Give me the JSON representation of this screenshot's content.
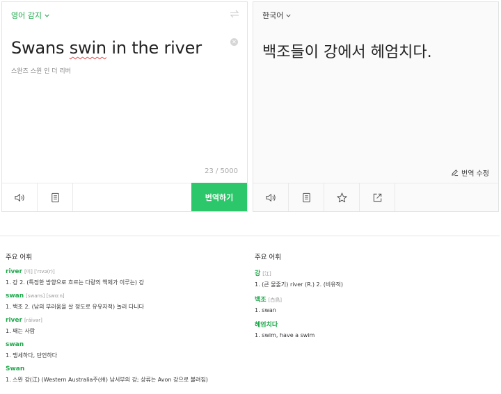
{
  "source": {
    "lang_label": "영어 감지",
    "text_before": "Swans ",
    "text_error": "swin",
    "text_after": " in the river",
    "pronunciation": "스완즈 스윈 인 더 리버",
    "char_count": "23 / 5000",
    "translate_button": "번역하기"
  },
  "target": {
    "lang_label": "한국어",
    "text": "백조들이 강에서 헤엄치다.",
    "edit_label": "번역 수정"
  },
  "vocab_left": {
    "heading": "주요 어휘",
    "entries": [
      {
        "word": "river",
        "phon": "[미] [ˈrɪvə(r)]",
        "meaning": "1. 강   2. (특정한 방향으로 흐르는 다량의 액체가 이루는) 강"
      },
      {
        "word": "swan",
        "phon": "[swans] [swɑːn]",
        "meaning": "1. 백조   2. (남의 부러움을 살 정도로 유유자적) 놀러 다니다"
      },
      {
        "word": "river",
        "phon": "[ráivər]",
        "meaning": "1. 째는 사람"
      },
      {
        "word": "swan",
        "phon": "",
        "meaning": "1. 맹세하다, 단언하다"
      },
      {
        "word": "Swan",
        "phon": "",
        "meaning": "1. 스완 강(江) (Western Australia주(州) 남서부의 강; 상류는 Avon 강으로 불려짐)"
      }
    ]
  },
  "vocab_right": {
    "heading": "주요 어휘",
    "entries": [
      {
        "word": "강",
        "phon": "[江]",
        "meaning": "1. (큰 물줄기) river (R.)   2. (비유적)"
      },
      {
        "word": "백조",
        "phon": "[白鳥]",
        "meaning": "1. swan"
      },
      {
        "word": "헤엄치다",
        "phon": "",
        "meaning": "1. swim, have a swim"
      }
    ]
  }
}
